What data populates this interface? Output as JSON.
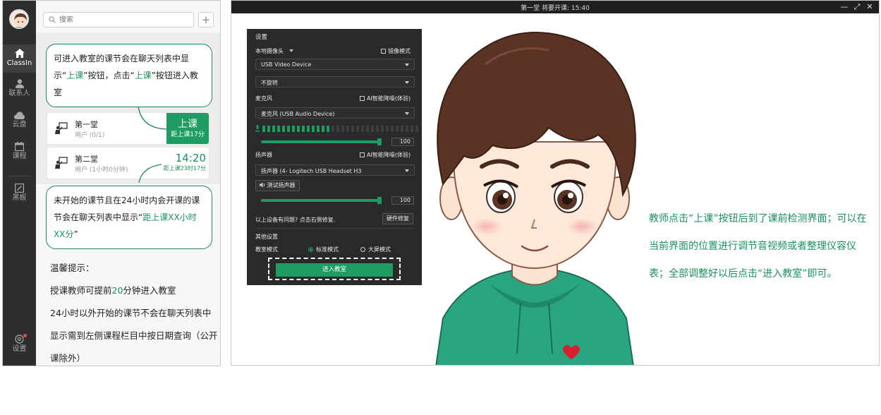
{
  "sidebar": {
    "items": [
      {
        "label": "ClassIn",
        "icon": "home-icon",
        "active": true
      },
      {
        "label": "联系人",
        "icon": "contacts-icon"
      },
      {
        "label": "云盘",
        "icon": "cloud-icon"
      },
      {
        "label": "课程",
        "icon": "calendar-icon"
      },
      {
        "label": "黑板",
        "icon": "blackboard-icon"
      }
    ],
    "settings_label": "设置"
  },
  "search": {
    "placeholder": "搜索",
    "add_symbol": "+"
  },
  "annotations": {
    "callout1": {
      "pre": "可进入教室的课节会在聊天列表中显示“",
      "hl1": "上课",
      "mid": "”按钮，点击“",
      "hl2": "上课",
      "post": "”按钮进入教室"
    },
    "callout2": {
      "pre": "未开始的课节且在24小时内会开课的课节会在聊天列表中显示“",
      "hl": "距上课XX小时XX分",
      "post": "”"
    }
  },
  "lessons": [
    {
      "name": "第一堂",
      "sub": "用户 (0/1)",
      "button_label": "上课",
      "countdown": "距上课17分"
    },
    {
      "name": "第二堂",
      "sub": "用户 (1小时0分钟)",
      "time": "14:20",
      "countdown": "距上课23时17分"
    }
  ],
  "tips": {
    "title": "温馨提示：",
    "line1_pre": "授课教师可提前",
    "line1_num": "20",
    "line1_post": "分钟进入教室",
    "line2": "24小时以外开始的课节不会在聊天列表中显示需到左侧课程栏目中按日期查询（公开课除外）"
  },
  "window": {
    "title": "第一堂  将要开课: 15:40",
    "minimize": "—",
    "restore": "⤢",
    "close": "✕"
  },
  "device_settings": {
    "title": "设置",
    "camera": {
      "label": "本地摄像头",
      "mirror": "镜像模式",
      "device": "USB Video Device",
      "rotation": "不旋转"
    },
    "mic": {
      "label": "麦克风",
      "ai_noise": "AI智能降噪(体验)",
      "device": "麦克风 (USB Audio Device)",
      "volume": "100",
      "level_fraction": 0.45
    },
    "speaker": {
      "label": "扬声器",
      "ai_noise": "AI智能降噪(体验)",
      "device": "扬声器 (4- Logitech USB Headset H3",
      "test_button": "测试扬声器",
      "volume": "100"
    },
    "issue_text": "以上设备有问题? 点击右侧修复.",
    "fix_button": "硬件修复",
    "other_label": "其他设置",
    "mode_label": "教室模式",
    "mode_standard": "标准模式",
    "mode_big": "大屏模式",
    "enter_button": "进入教室"
  },
  "description": "教师点击“上课”按钮后到了课前检测界面；可以在当前界面的位置进行调节音视频或者整理仪容仪表；全部调整好以后点击“进入教室”即可。",
  "colors": {
    "accent": "#1e9c62",
    "text_green": "#17925a",
    "dark_bg": "#2a2a2a"
  }
}
